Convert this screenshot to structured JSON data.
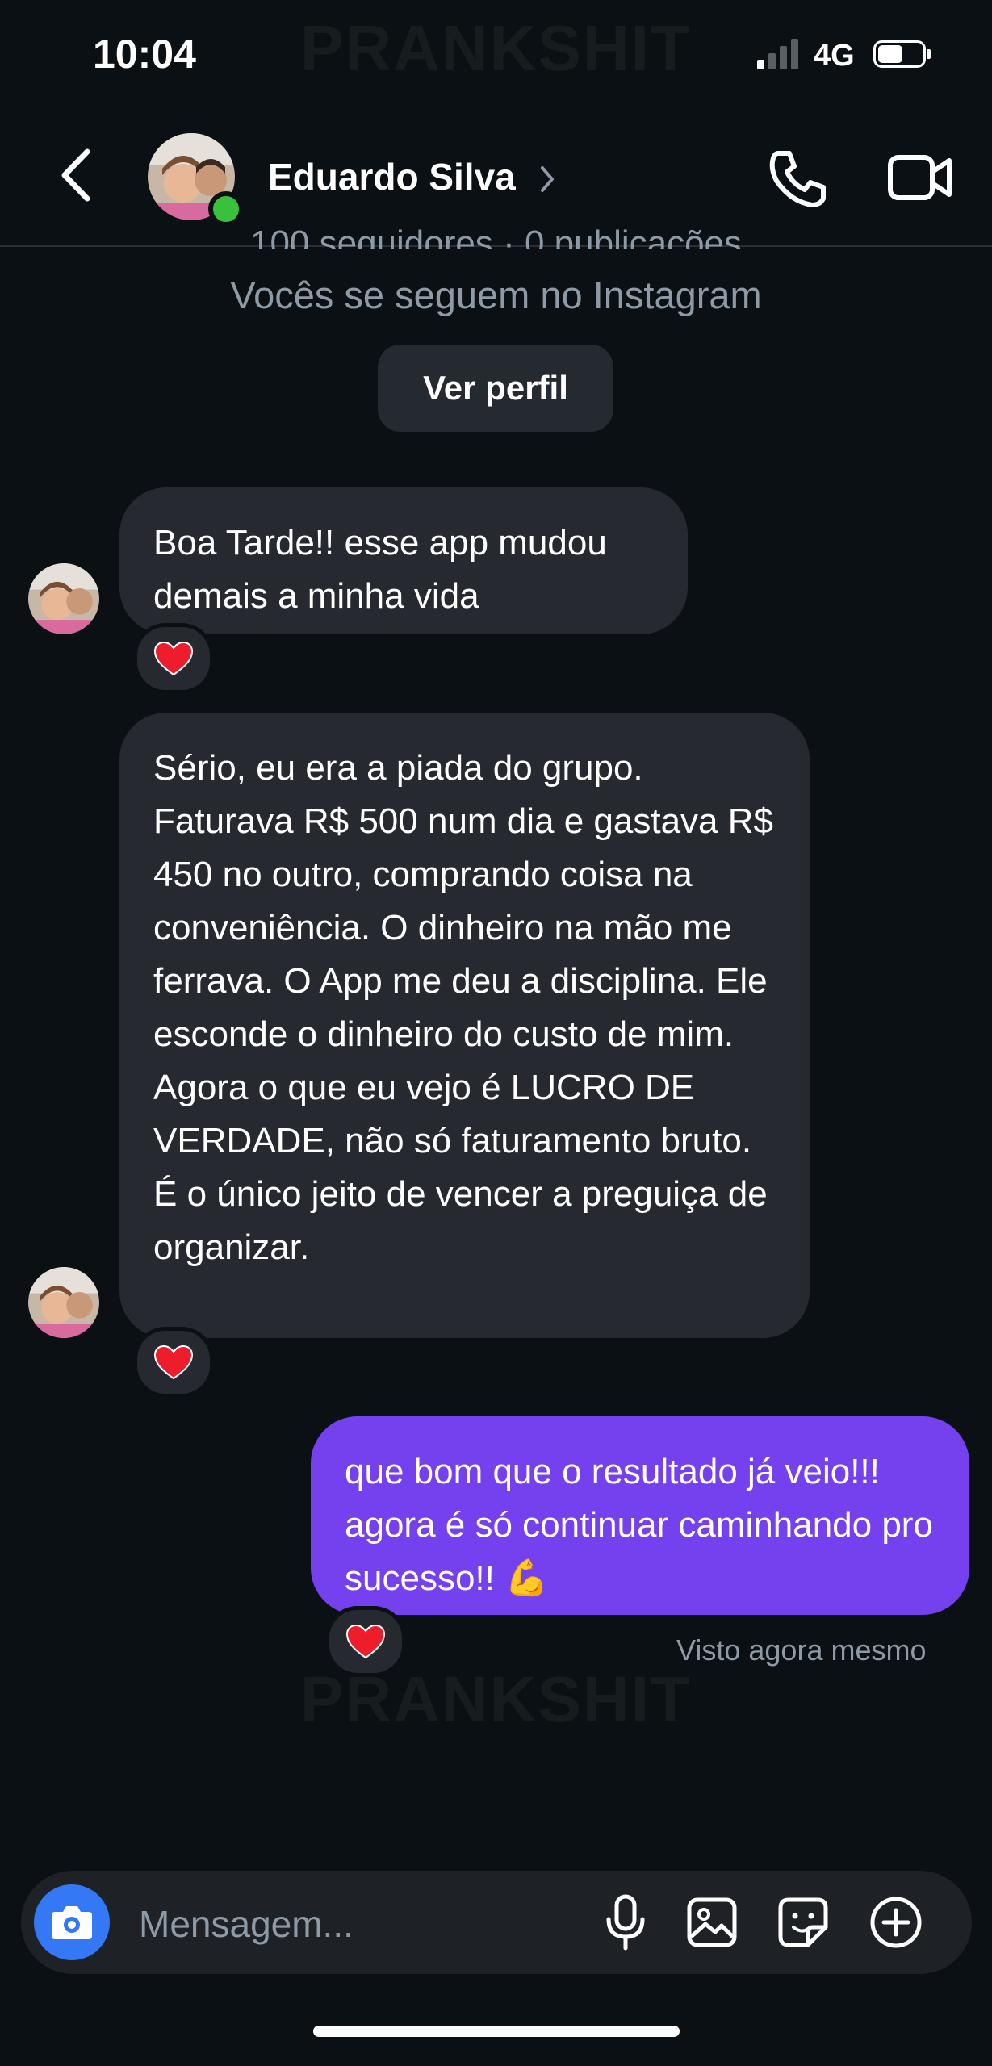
{
  "status_bar": {
    "time": "10:04",
    "network": "4G",
    "watermark": "PRANKSHIT"
  },
  "header": {
    "contact_name": "Eduardo Silva"
  },
  "profile": {
    "followers_line": "100 seguidores · 0 publicações",
    "mutual_line": "Vocês se seguem no Instagram",
    "view_profile_label": "Ver perfil"
  },
  "messages": [
    {
      "direction": "in",
      "text": "Boa Tarde!! esse app mudou demais a minha  vida",
      "reaction": "heart"
    },
    {
      "direction": "in",
      "text": "Sério, eu era a piada do grupo. Faturava R$ 500 num dia e gastava R$ 450 no outro, comprando coisa na conveniência. O dinheiro na mão me ferrava. O App me deu a disciplina. Ele esconde o dinheiro do custo de mim. Agora o que eu vejo é LUCRO DE VERDADE, não só faturamento bruto. É o único jeito de vencer a preguiça de organizar.",
      "reaction": "heart"
    },
    {
      "direction": "out",
      "text": "que bom que o resultado já veio!!! agora é só continuar caminhando pro sucesso!! 💪",
      "reaction": "heart"
    }
  ],
  "seen_label": "Visto agora mesmo",
  "composer": {
    "placeholder": "Mensagem..."
  },
  "colors": {
    "background": "#0b1014",
    "incoming_bubble": "#262a30",
    "outgoing_bubble": "#7540ed",
    "camera_button": "#3478f6",
    "online": "#3ac13c"
  }
}
